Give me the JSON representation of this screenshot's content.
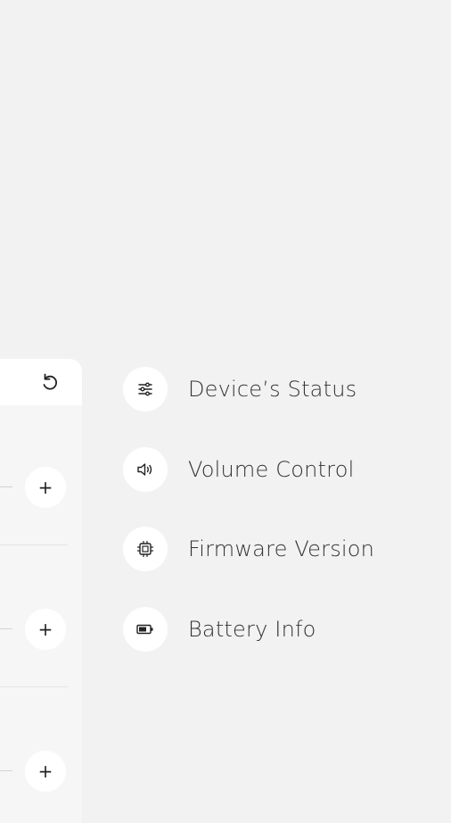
{
  "panel": {
    "reset_icon": "undo-icon",
    "add_button_label": "+",
    "add_buttons": [
      "+",
      "+",
      "+"
    ]
  },
  "menu": {
    "items": [
      {
        "label": "Device’s Status",
        "icon": "sliders-icon"
      },
      {
        "label": "Volume Control",
        "icon": "speaker-icon"
      },
      {
        "label": "Firmware Version",
        "icon": "chip-icon"
      },
      {
        "label": "Battery Info",
        "icon": "battery-icon"
      }
    ]
  },
  "colors": {
    "background": "#f2f2f2",
    "panel": "#f6f6f7",
    "surface": "#ffffff",
    "text": "#333333"
  }
}
